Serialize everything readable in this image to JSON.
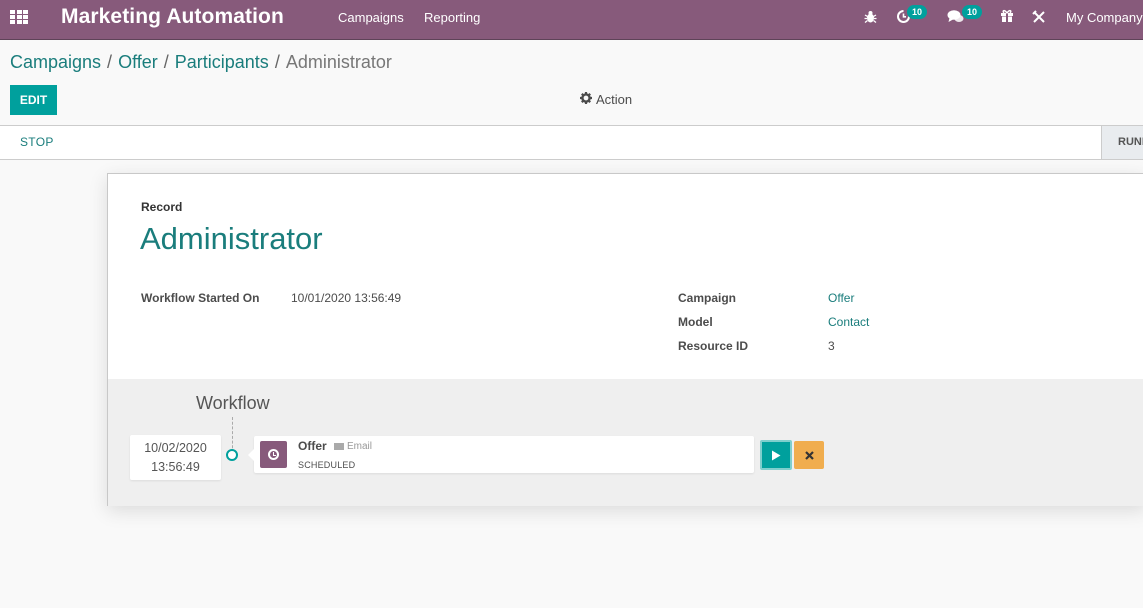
{
  "navbar": {
    "app_title": "Marketing Automation",
    "menus": [
      "Campaigns",
      "Reporting"
    ],
    "activity_count": "10",
    "messages_count": "10",
    "company": "My Company"
  },
  "breadcrumb": {
    "items": [
      "Campaigns",
      "Offer",
      "Participants"
    ],
    "current": "Administrator",
    "separator": "/"
  },
  "toolbar": {
    "edit_label": "EDIT",
    "action_label": "Action"
  },
  "statusbar": {
    "stop_label": "STOP",
    "stage_label": "RUNNING"
  },
  "record": {
    "label": "Record",
    "name": "Administrator",
    "fields_left": [
      {
        "label": "Workflow Started On",
        "value": "10/01/2020 13:56:49"
      }
    ],
    "fields_right": [
      {
        "label": "Campaign",
        "value": "Offer"
      },
      {
        "label": "Model",
        "value": "Contact"
      },
      {
        "label": "Resource ID",
        "value": "3"
      }
    ]
  },
  "workflow": {
    "title": "Workflow",
    "items": [
      {
        "date": "10/02/2020",
        "time": "13:56:49",
        "name": "Offer",
        "type": "Email",
        "state": "SCHEDULED"
      }
    ]
  },
  "colors": {
    "brand": "#875a7b",
    "primary": "#00a09d",
    "link": "#1a7d7c",
    "warning": "#f0ad4e"
  }
}
